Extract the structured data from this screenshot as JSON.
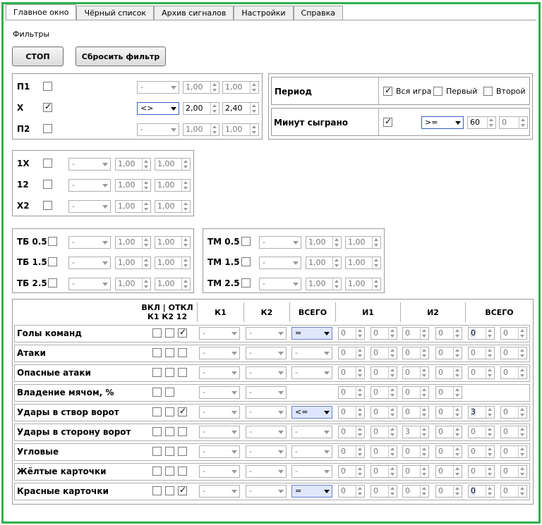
{
  "tabs": [
    "Главное окно",
    "Чёрный список",
    "Архив сигналов",
    "Настройки",
    "Справка"
  ],
  "filters_label": "Фильтры",
  "buttons": {
    "stop": "СТОП",
    "reset": "Сбросить фильтр"
  },
  "outcomes": [
    {
      "label": "П1",
      "checked": false,
      "op": "-",
      "v1": "1,00",
      "v2": "1,00"
    },
    {
      "label": "Х",
      "checked": true,
      "op": "<>",
      "v1": "2,00",
      "v2": "2,40"
    },
    {
      "label": "П2",
      "checked": false,
      "op": "-",
      "v1": "1,00",
      "v2": "1,00"
    }
  ],
  "period": {
    "label": "Период",
    "options": [
      {
        "label": "Вся игра",
        "checked": true
      },
      {
        "label": "Первый",
        "checked": false
      },
      {
        "label": "Второй",
        "checked": false
      }
    ],
    "minutes_label": "Минут сыграно",
    "minutes_checked": true,
    "minutes_op": ">=",
    "minutes_v1": "60",
    "minutes_v2": "0"
  },
  "double_chance": [
    {
      "label": "1Х",
      "op": "-",
      "v1": "1,00",
      "v2": "1,00"
    },
    {
      "label": "12",
      "op": "-",
      "v1": "1,00",
      "v2": "1,00"
    },
    {
      "label": "Х2",
      "op": "-",
      "v1": "1,00",
      "v2": "1,00"
    }
  ],
  "total_over": [
    {
      "label": "ТБ 0.5",
      "op": "-",
      "v1": "1,00",
      "v2": "1,00"
    },
    {
      "label": "ТБ 1.5",
      "op": "-",
      "v1": "1,00",
      "v2": "1,00"
    },
    {
      "label": "ТБ 2.5",
      "op": "-",
      "v1": "1,00",
      "v2": "1,00"
    }
  ],
  "total_under": [
    {
      "label": "ТМ 0.5",
      "op": "-",
      "v1": "1,00",
      "v2": "1,00"
    },
    {
      "label": "ТМ 1.5",
      "op": "-",
      "v1": "1,00",
      "v2": "1,00"
    },
    {
      "label": "ТМ 2.5",
      "op": "-",
      "v1": "1,00",
      "v2": "1,00"
    }
  ],
  "stats_headers": {
    "toggle_line1": "ВКЛ | ОТКЛ",
    "toggle_line2": "К1 К2 12",
    "k1": "К1",
    "k2": "К2",
    "total1": "ВСЕГО",
    "i1": "И1",
    "i2": "И2",
    "total2": "ВСЕГО"
  },
  "stats": [
    {
      "label": "Голы команд",
      "c": [
        false,
        false,
        true
      ],
      "k1": "-",
      "k2": "-",
      "total": "=",
      "vals": [
        "0",
        "0",
        "0",
        "0",
        "0",
        "0"
      ]
    },
    {
      "label": "Атаки",
      "c": [
        false,
        false,
        false
      ],
      "k1": "-",
      "k2": "-",
      "total": "-",
      "vals": [
        "0",
        "0",
        "0",
        "0",
        "0",
        "0"
      ]
    },
    {
      "label": "Опасные атаки",
      "c": [
        false,
        false,
        false
      ],
      "k1": "-",
      "k2": "-",
      "total": "-",
      "vals": [
        "0",
        "0",
        "0",
        "0",
        "0",
        "0"
      ]
    },
    {
      "label": "Владение мячом, %",
      "c": [
        false,
        false
      ],
      "k1": "-",
      "k2": "-",
      "total": "",
      "vals": [
        "0",
        "0",
        "0",
        "0"
      ]
    },
    {
      "label": "Удары в створ ворот",
      "c": [
        false,
        false,
        true
      ],
      "k1": "-",
      "k2": "-",
      "total": "<=",
      "vals": [
        "0",
        "0",
        "0",
        "0",
        "3",
        "0"
      ]
    },
    {
      "label": "Удары в сторону ворот",
      "c": [
        false,
        false,
        false
      ],
      "k1": "-",
      "k2": "-",
      "total": "-",
      "vals": [
        "0",
        "0",
        "3",
        "0",
        "0",
        "0"
      ]
    },
    {
      "label": "Угловые",
      "c": [
        false,
        false,
        false
      ],
      "k1": "-",
      "k2": "-",
      "total": "-",
      "vals": [
        "0",
        "0",
        "0",
        "0",
        "0",
        "0"
      ]
    },
    {
      "label": "Жёлтые карточки",
      "c": [
        false,
        false,
        false
      ],
      "k1": "-",
      "k2": "-",
      "total": "-",
      "vals": [
        "0",
        "0",
        "0",
        "0",
        "0",
        "0"
      ]
    },
    {
      "label": "Красные карточки",
      "c": [
        false,
        false,
        true
      ],
      "k1": "-",
      "k2": "-",
      "total": "=",
      "vals": [
        "0",
        "0",
        "0",
        "0",
        "0",
        "0"
      ]
    }
  ],
  "colors": {
    "frame": "#2fb24c",
    "selection": "#dfe7ff"
  }
}
